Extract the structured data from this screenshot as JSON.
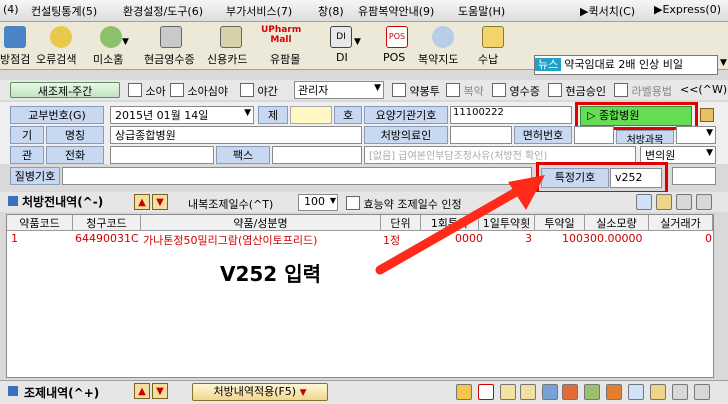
{
  "menu": {
    "items": [
      "(4)",
      "컨설팅통계(5)",
      "환경설정/도구(6)",
      "부가서비스(7)",
      "창(8)",
      "유팜복약안내(9)",
      "도움말(H)"
    ],
    "right": [
      "▶퀵서치(C)",
      "▶Express(0)"
    ]
  },
  "toolbar": {
    "items": [
      "방점검",
      "오류검색",
      "미소홈",
      "현금영수증",
      "신용카드",
      "유팜몰",
      "DI",
      "POS",
      "복약지도",
      "수납"
    ],
    "upharm_logo": "UPharm Mall",
    "news_tag": "뉴스",
    "news_text": "약국임대료 2배 인상 비일"
  },
  "patient_bar": {
    "new_button": "새조제-주간",
    "cb_child": "소아",
    "cb_child_night": "소아심야",
    "cb_night": "야간",
    "manager_select": "관리자",
    "cb_drug": "약봉투",
    "cb_dup": "복약",
    "cb_receipt": "영수증",
    "cb_cash": "현금승인",
    "cb_label": "라벨용법",
    "nav": "<<(^W)"
  },
  "form": {
    "exchange_no_label": "교부번호(G)",
    "date_value": "2015년 01월 14일",
    "no_label": "제",
    "ho_label": "호",
    "inst_code_label": "요양기관기호",
    "inst_code_value": "11100222",
    "hospital_button": "▷ 종합병원",
    "gi_label": "기",
    "gwan_label": "관",
    "name_label": "명칭",
    "name_value": "상급종합병원",
    "doctor_label": "처방의료인",
    "license_label": "면허번호",
    "special_label": "처방과목",
    "phone_label": "전화",
    "fax_label": "팩스",
    "burden_value": "[없음] 급여본인부담조정사유(처방전 확인)",
    "special_select": "변의원",
    "disease_label": "질병기호",
    "special_code_label": "특정기호",
    "special_code_value": "v252"
  },
  "rx_section": {
    "title": "처방전내역(^-)",
    "days_label": "내복조제일수(^T)",
    "days_value": "100",
    "cb_effect": "효능약 조제일수 인정"
  },
  "grid": {
    "headers": [
      "약품코드",
      "청구코드",
      "약품/성분명",
      "단위",
      "1회투약",
      "1일투약횟",
      "투약일",
      "실소모량",
      "실거래가"
    ],
    "rows": [
      [
        "1",
        "64490031C",
        "가나톤정50밀리그람(염산이토프리드)",
        "1정",
        "0000",
        "3",
        "100",
        "300.00000",
        "0"
      ]
    ]
  },
  "annotation": "V252 입력",
  "bottom": {
    "title": "조제내역(^+)",
    "apply_button": "처방내역적용(F5)"
  }
}
